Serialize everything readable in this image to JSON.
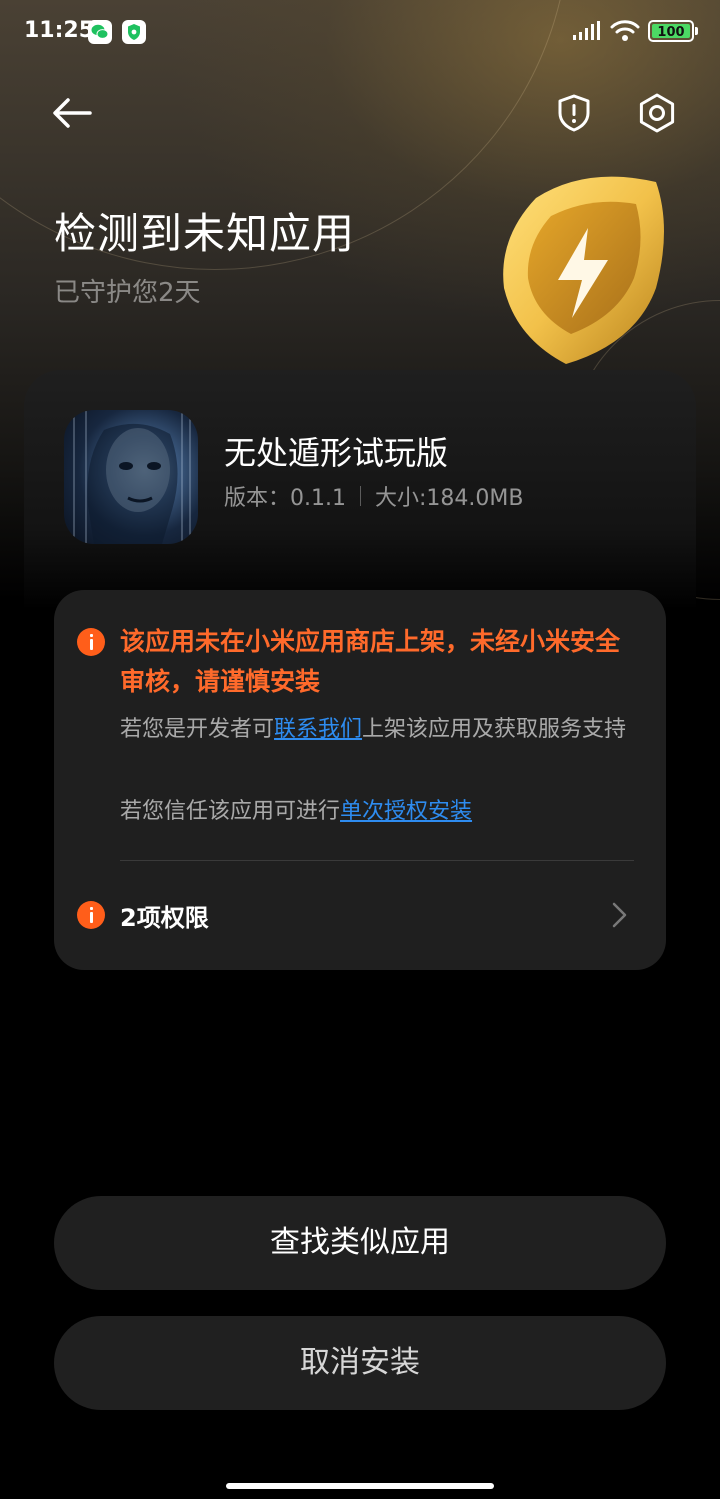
{
  "status_bar": {
    "time": "11:25",
    "battery": "100",
    "icons": [
      "wechat-icon",
      "shield-app-icon",
      "signal-icon",
      "wifi-icon",
      "battery-icon"
    ]
  },
  "header": {
    "back_icon": "arrow-left-icon",
    "shield_icon": "shield-alert-icon",
    "settings_icon": "settings-icon",
    "title": "检测到未知应用",
    "subtitle": "已守护您2天"
  },
  "app": {
    "name": "无处遁形试玩版",
    "version": "版本：0.1.1",
    "size": "大小:184.0MB"
  },
  "warning": {
    "title": "该应用未在小米应用商店上架，未经小米安全审核，请谨慎安装",
    "line1_prefix": "若您是开发者可",
    "line1_link": "联系我们",
    "line1_suffix": "上架该应用及获取服务支持",
    "line2_prefix": "若您信任该应用可进行",
    "line2_link": "单次授权安装",
    "permissions": "2项权限"
  },
  "buttons": {
    "find_similar": "查找类似应用",
    "cancel_install": "取消安装"
  },
  "colors": {
    "warning": "#ff5e1a",
    "link": "#2e8cf0",
    "background": "#000000",
    "card": "#1f1f1f",
    "battery": "#4cd964",
    "badge": "#f2c14a"
  }
}
